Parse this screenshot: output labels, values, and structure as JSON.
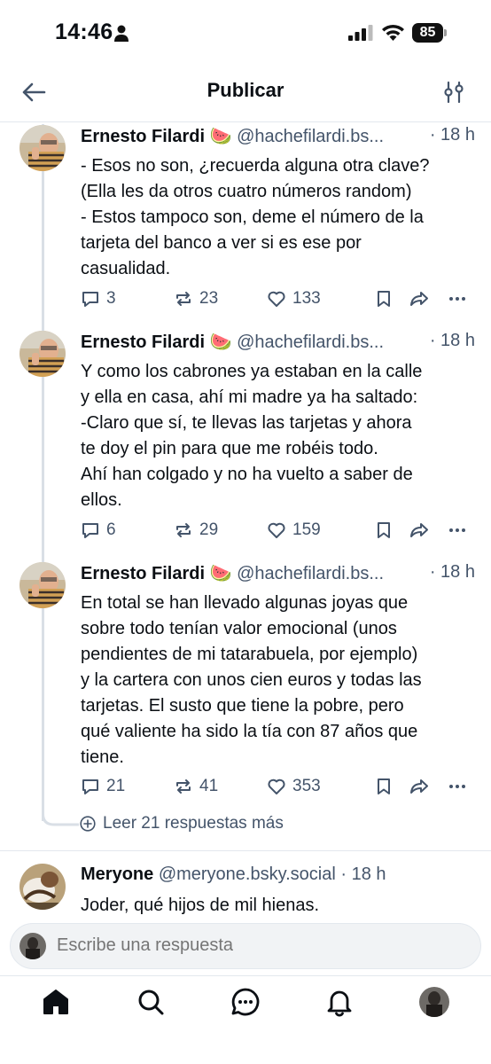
{
  "status_bar": {
    "time": "14:46",
    "battery": "85"
  },
  "header": {
    "title": "Publicar"
  },
  "posts": [
    {
      "author": "Ernesto Filardi 🍉",
      "handle": "@hachefilardi.bs...",
      "time": "· 18 h",
      "text": "- Esos no son, ¿recuerda alguna otra clave?\n(Ella les da otros cuatro números random)\n- Estos tampoco son, deme el número de la\ntarjeta del banco a ver si es ese por\ncasualidad.",
      "replies": "3",
      "reposts": "23",
      "likes": "133"
    },
    {
      "author": "Ernesto Filardi 🍉",
      "handle": "@hachefilardi.bs...",
      "time": "· 18 h",
      "text": "Y como los cabrones ya estaban en la calle\ny ella en casa, ahí mi madre ya ha saltado:\n-Claro que sí, te llevas las tarjetas y ahora\nte doy el pin para que me robéis todo.\nAhí han colgado y no ha vuelto a saber de\nellos.",
      "replies": "6",
      "reposts": "29",
      "likes": "159"
    },
    {
      "author": "Ernesto Filardi 🍉",
      "handle": "@hachefilardi.bs...",
      "time": "· 18 h",
      "text": "En total se han llevado algunas joyas que\nsobre todo tenían valor emocional (unos\npendientes de mi tatarabuela, por ejemplo)\ny la cartera con unos cien euros y todas las\ntarjetas. El susto que tiene la pobre, pero\nqué valiente ha sido la tía con 87 años que\ntiene.",
      "replies": "21",
      "reposts": "41",
      "likes": "353"
    }
  ],
  "more_replies": "Leer 21 respuestas más",
  "reply_post": {
    "author": "Meryone",
    "handle": "@meryone.bsky.social",
    "time": "· 18 h",
    "text": "Joder, qué hijos de mil hienas."
  },
  "composer": {
    "placeholder": "Escribe una respuesta"
  },
  "colors": {
    "accent": "#1083fe",
    "muted": "#44546a",
    "divider": "#e3e8ee"
  },
  "icons": [
    "back-arrow-icon",
    "filter-icon",
    "reply-icon",
    "repost-icon",
    "like-icon",
    "bookmark-icon",
    "share-icon",
    "more-icon",
    "home-icon",
    "search-icon",
    "chat-icon",
    "bell-icon"
  ]
}
